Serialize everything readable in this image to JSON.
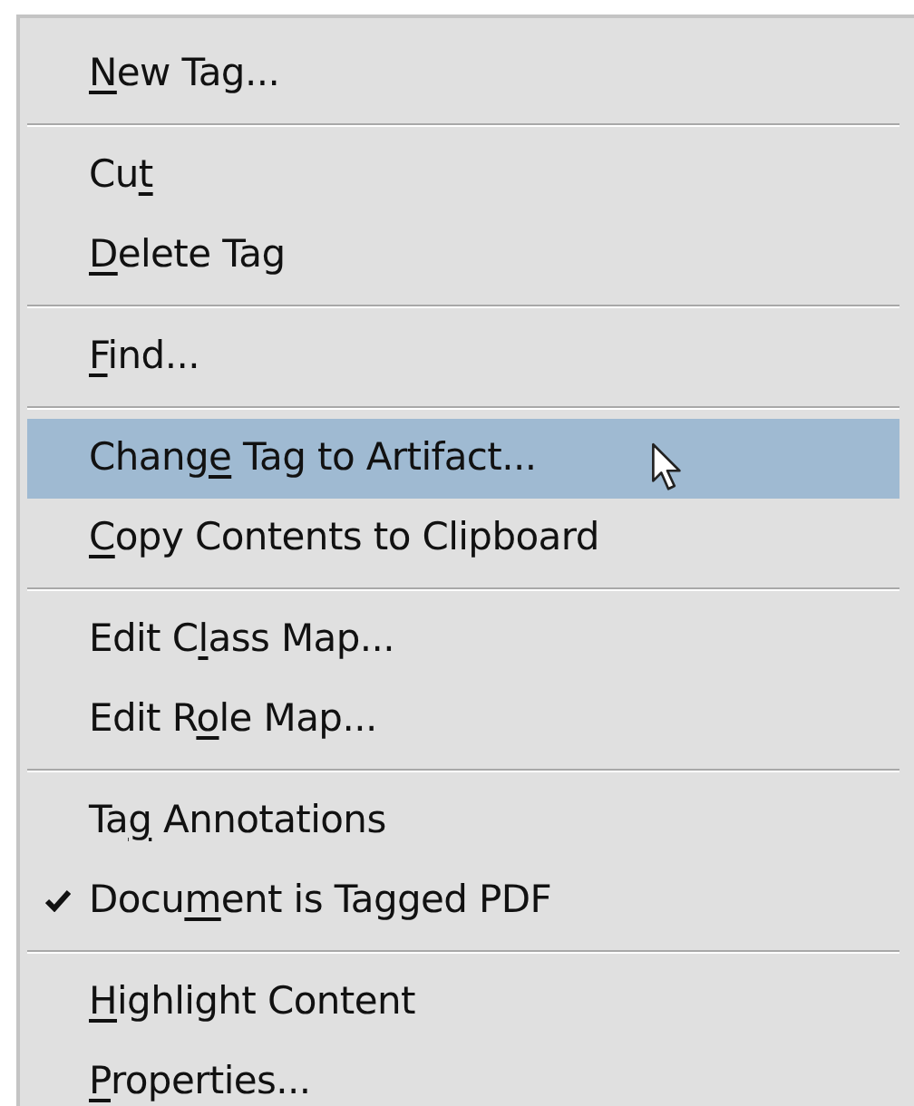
{
  "menu": {
    "groups": [
      {
        "items": [
          {
            "key": "N",
            "post": "ew Tag...",
            "selected": false,
            "checked": false
          }
        ]
      },
      {
        "items": [
          {
            "pre": "Cu",
            "key": "t",
            "selected": false,
            "checked": false
          },
          {
            "key": "D",
            "post": "elete Tag",
            "selected": false,
            "checked": false
          }
        ]
      },
      {
        "items": [
          {
            "key": "F",
            "post": "ind...",
            "selected": false,
            "checked": false
          }
        ]
      },
      {
        "items": [
          {
            "pre": "Chang",
            "key": "e",
            "post": " Tag to Artifact...",
            "selected": true,
            "checked": false
          },
          {
            "key": "C",
            "post": "opy Contents to Clipboard",
            "selected": false,
            "checked": false
          }
        ]
      },
      {
        "items": [
          {
            "pre": "Edit C",
            "key": "l",
            "post": "ass Map...",
            "selected": false,
            "checked": false
          },
          {
            "pre": "Edit R",
            "key": "o",
            "post": "le Map...",
            "selected": false,
            "checked": false
          }
        ]
      },
      {
        "items": [
          {
            "pre": "Ta",
            "key": "g",
            "post": " Annotations",
            "selected": false,
            "checked": false
          },
          {
            "pre": "Docu",
            "key": "m",
            "post": "ent is Tagged PDF",
            "selected": false,
            "checked": true
          }
        ]
      },
      {
        "items": [
          {
            "key": "H",
            "post": "ighlight Content",
            "selected": false,
            "checked": false
          },
          {
            "key": "P",
            "post": "roperties...",
            "selected": false,
            "checked": false
          }
        ]
      }
    ]
  }
}
